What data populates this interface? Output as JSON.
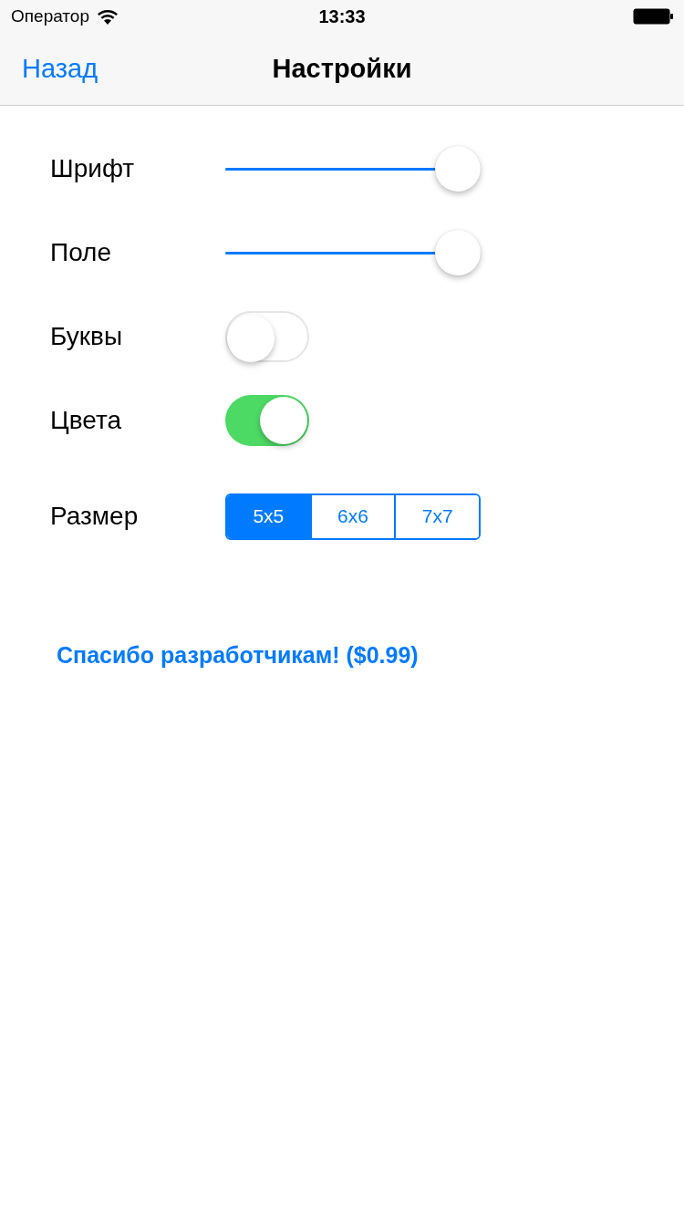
{
  "status_bar": {
    "carrier": "Оператор",
    "time": "13:33"
  },
  "nav_bar": {
    "back": "Назад",
    "title": "Настройки"
  },
  "settings": [
    {
      "kind": "slider",
      "label": "Шрифт",
      "level": 1
    },
    {
      "kind": "slider",
      "label": "Поле",
      "level": 1
    },
    {
      "kind": "switch",
      "label": "Буквы",
      "on": false
    },
    {
      "kind": "switch",
      "label": "Цвета",
      "on": true
    },
    {
      "kind": "segmented",
      "label": "Размер",
      "segments": [
        {
          "label": "5x5",
          "selected": true
        },
        {
          "label": "6x6",
          "selected": false
        },
        {
          "label": "7x7",
          "selected": false
        }
      ]
    }
  ],
  "donate_link": "Спасибо разработчикам! ($0.99)"
}
